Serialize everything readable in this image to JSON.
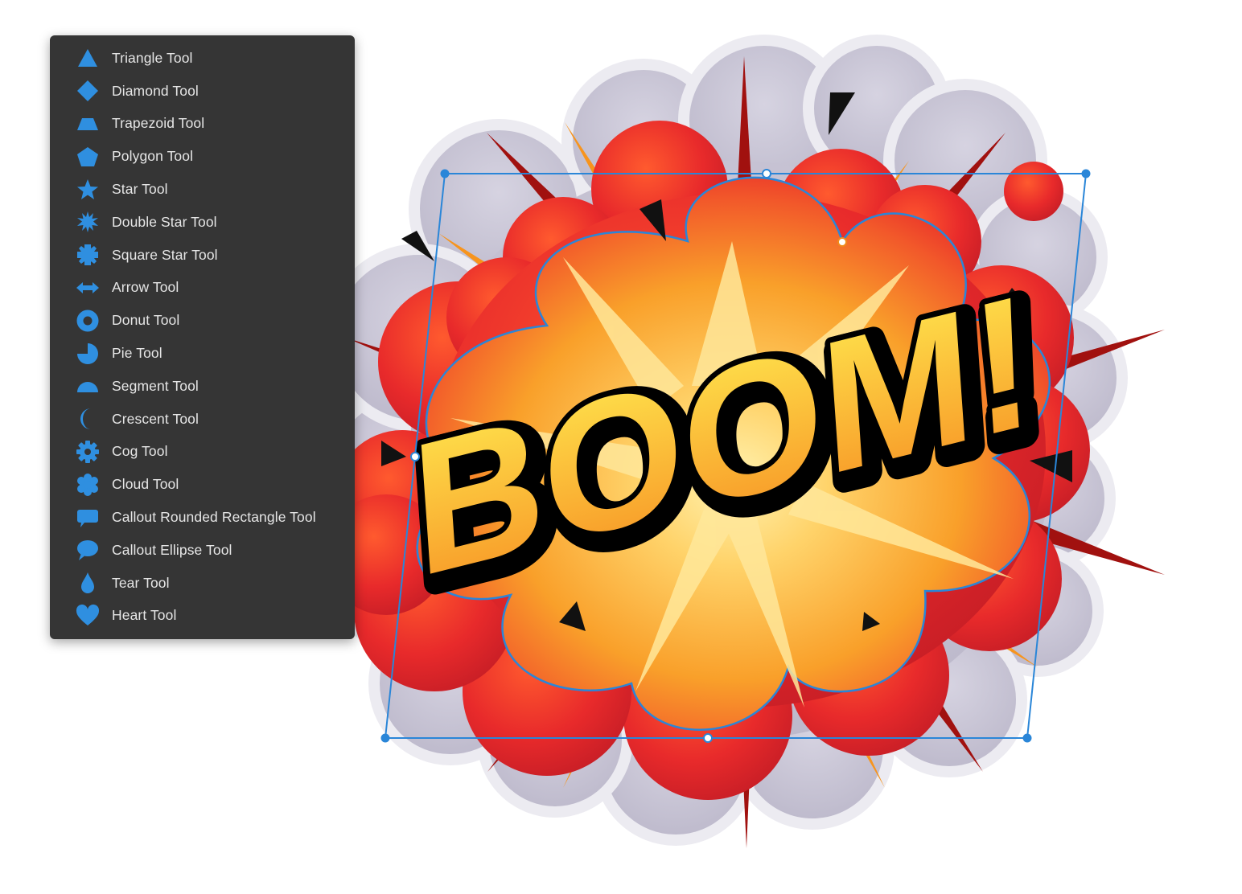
{
  "tool_menu": {
    "accent_color": "#2f8fe0",
    "items": [
      {
        "label": "Triangle Tool",
        "icon": "triangle-icon"
      },
      {
        "label": "Diamond Tool",
        "icon": "diamond-icon"
      },
      {
        "label": "Trapezoid Tool",
        "icon": "trapezoid-icon"
      },
      {
        "label": "Polygon Tool",
        "icon": "polygon-icon"
      },
      {
        "label": "Star Tool",
        "icon": "star-icon"
      },
      {
        "label": "Double Star Tool",
        "icon": "double-star-icon"
      },
      {
        "label": "Square Star Tool",
        "icon": "square-star-icon"
      },
      {
        "label": "Arrow Tool",
        "icon": "arrow-icon"
      },
      {
        "label": "Donut Tool",
        "icon": "donut-icon"
      },
      {
        "label": "Pie Tool",
        "icon": "pie-icon"
      },
      {
        "label": "Segment Tool",
        "icon": "segment-icon"
      },
      {
        "label": "Crescent Tool",
        "icon": "crescent-icon"
      },
      {
        "label": "Cog Tool",
        "icon": "cog-icon"
      },
      {
        "label": "Cloud Tool",
        "icon": "cloud-icon"
      },
      {
        "label": "Callout Rounded Rectangle Tool",
        "icon": "callout-rounded-rectangle-icon"
      },
      {
        "label": "Callout Ellipse Tool",
        "icon": "callout-ellipse-icon"
      },
      {
        "label": "Tear Tool",
        "icon": "tear-icon"
      },
      {
        "label": "Heart Tool",
        "icon": "heart-icon"
      }
    ]
  },
  "artwork": {
    "text": "BOOM!",
    "smoke_color": "#c9c6d6",
    "red_color": "#e3262b",
    "orange_color": "#f7941d",
    "yellow_color": "#ffe05a",
    "selection_color": "#2a86d8"
  }
}
